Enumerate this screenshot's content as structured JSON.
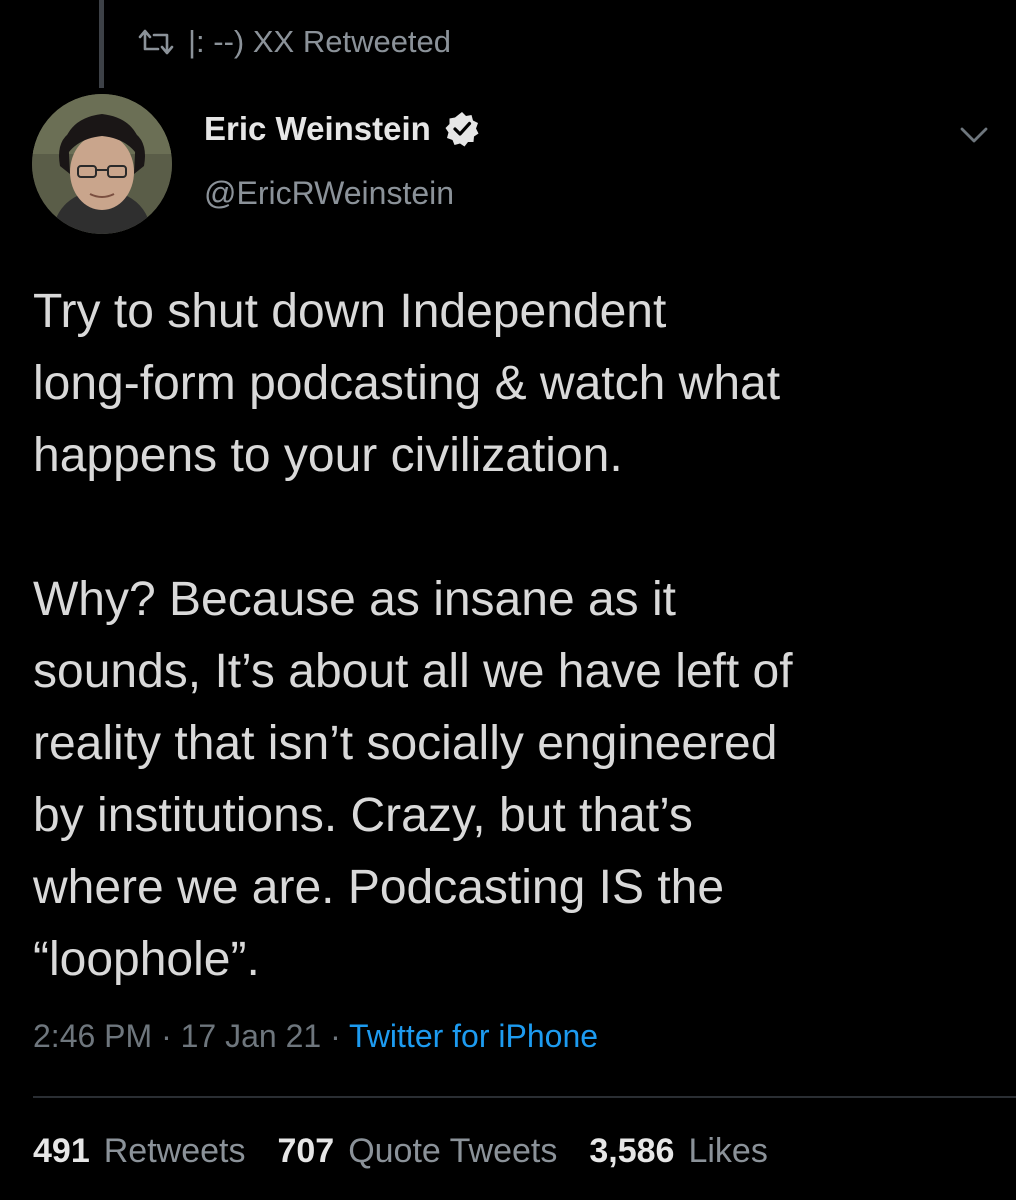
{
  "retweet": {
    "icon": "retweet-icon",
    "label": "|: --) XX Retweeted"
  },
  "author": {
    "name": "Eric Weinstein",
    "handle": "@EricRWeinstein",
    "verified": true,
    "verified_icon": "verified-badge-icon"
  },
  "menu": {
    "icon": "chevron-down-icon"
  },
  "tweet": {
    "text": "Try to shut down Independent\nlong-form podcasting & watch what\nhappens to your civilization.\n\nWhy? Because as insane as it\nsounds, It’s about all we have left of\nreality that isn’t socially engineered\nby institutions. Crazy, but that’s\nwhere we are. Podcasting IS the\n“loophole”."
  },
  "meta": {
    "time": "2:46 PM",
    "separator": "·",
    "date": "17 Jan 21",
    "source": "Twitter for iPhone"
  },
  "stats": {
    "retweets_count": "491",
    "retweets_label": "Retweets",
    "quotes_count": "707",
    "quotes_label": "Quote Tweets",
    "likes_count": "3,586",
    "likes_label": "Likes"
  },
  "colors": {
    "background": "#000000",
    "text_primary": "#d9d9d9",
    "text_secondary": "#8b9299",
    "link": "#1d9bf0"
  }
}
